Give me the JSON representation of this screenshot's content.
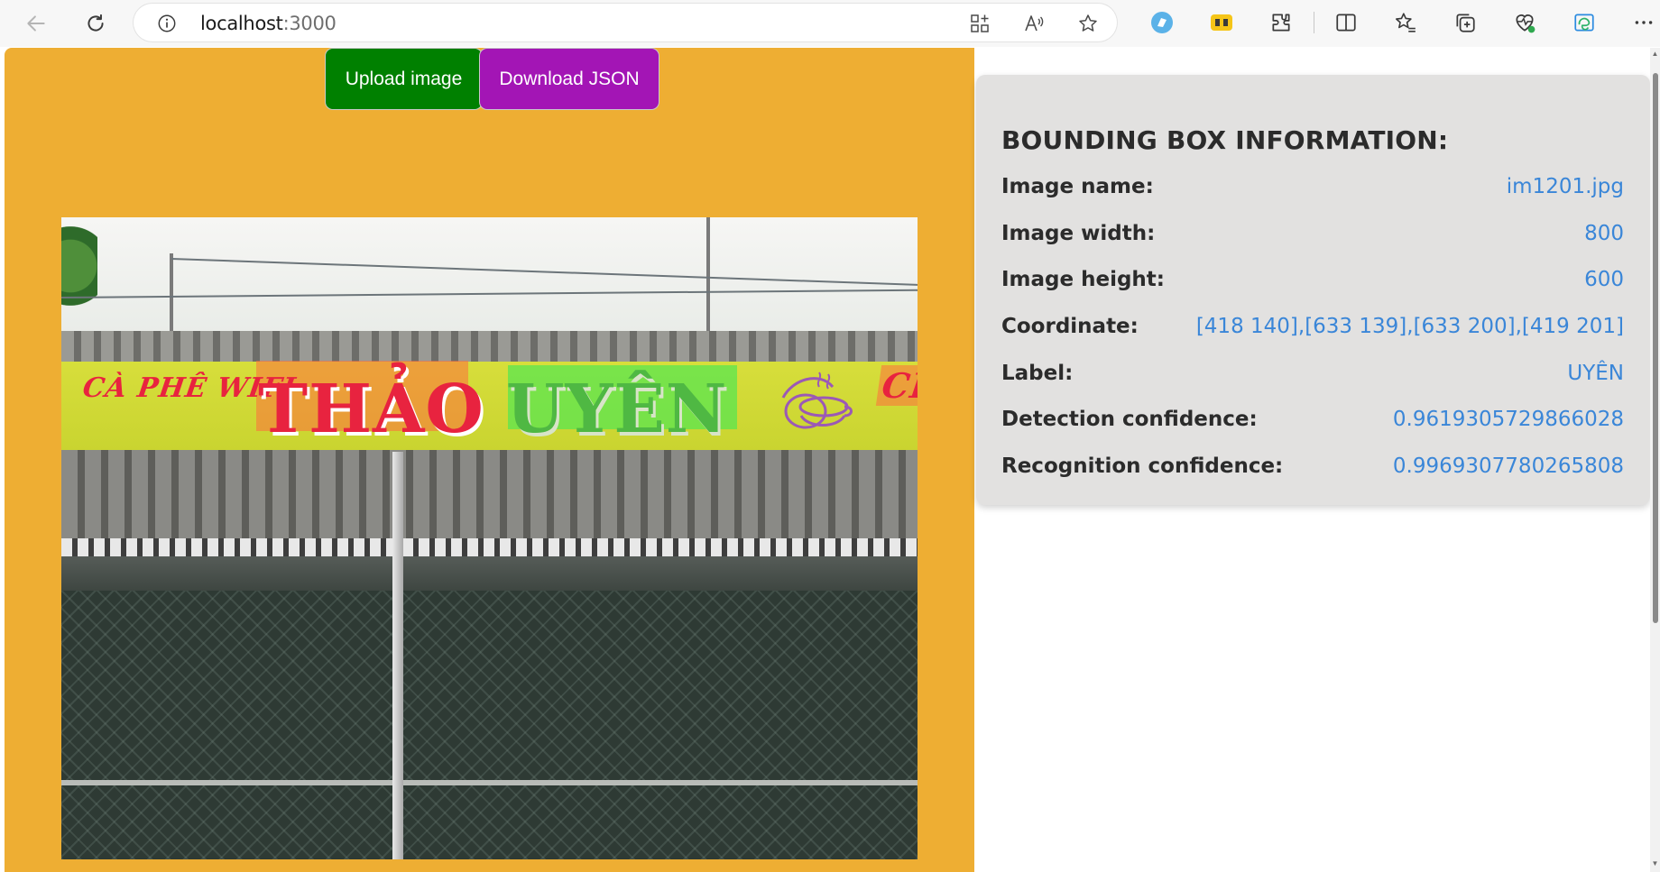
{
  "browser": {
    "url_host": "localhost",
    "url_port": ":3000",
    "icons": [
      "back-arrow-icon",
      "refresh-icon",
      "info-icon",
      "apps-grid-icon",
      "read-aloud-icon",
      "favorite-star-icon",
      "copilot-icon",
      "reader-icon",
      "extensions-icon",
      "split-screen-icon",
      "favorites-icon",
      "collections-icon",
      "performance-icon",
      "edge-icon",
      "more-icon"
    ]
  },
  "toolbar": {
    "upload_label": "Upload image",
    "download_label": "Download JSON",
    "upload_color": "#008000",
    "download_color": "#a315b5"
  },
  "photo": {
    "sign_texts": [
      "CÀ PHÊ WIFI",
      "THẢO",
      "UYÊN",
      "CH"
    ]
  },
  "info": {
    "title": "BOUNDING BOX INFORMATION:",
    "rows": [
      {
        "key": "Image name:",
        "value": "im1201.jpg"
      },
      {
        "key": "Image width:",
        "value": "800"
      },
      {
        "key": "Image height:",
        "value": "600"
      },
      {
        "key": "Coordinate:",
        "value": "[418 140],[633 139],[633 200],[419 201]"
      },
      {
        "key": "Label:",
        "value": "UYÊN"
      },
      {
        "key": "Detection confidence:",
        "value": "0.9619305729866028"
      },
      {
        "key": "Recognition confidence:",
        "value": "0.9969307780265808"
      }
    ]
  },
  "colors": {
    "background": "#eeae33",
    "panel": "#e2e1e0",
    "value_text": "#3a86d8"
  }
}
